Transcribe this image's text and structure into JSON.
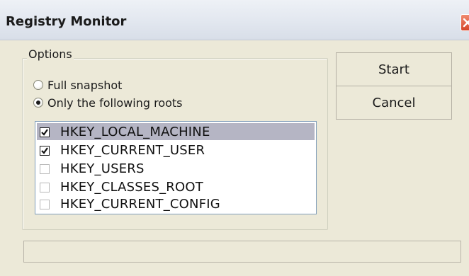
{
  "window": {
    "title": "Registry Monitor"
  },
  "options": {
    "label": "Options",
    "radios": [
      {
        "label": "Full snapshot",
        "selected": false
      },
      {
        "label": "Only the following roots",
        "selected": true
      }
    ],
    "roots": [
      {
        "label": "HKEY_LOCAL_MACHINE",
        "checked": true,
        "selected": true
      },
      {
        "label": "HKEY_CURRENT_USER",
        "checked": true,
        "selected": false
      },
      {
        "label": "HKEY_USERS",
        "checked": false,
        "selected": false
      },
      {
        "label": "HKEY_CLASSES_ROOT",
        "checked": false,
        "selected": false
      },
      {
        "label": "HKEY_CURRENT_CONFIG",
        "checked": false,
        "selected": false
      }
    ]
  },
  "buttons": {
    "start": "Start",
    "cancel": "Cancel"
  },
  "status": {
    "text": ""
  },
  "colors": {
    "face": "#ece9d8",
    "selection": "#b5b5c4",
    "close": "#d5452a"
  },
  "icons": {
    "close": "close-icon",
    "check": "checkmark-icon"
  }
}
